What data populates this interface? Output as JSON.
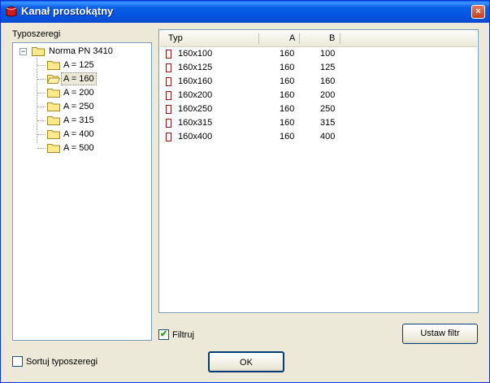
{
  "window": {
    "title": "Kanał prostokątny",
    "close_glyph": "×"
  },
  "left": {
    "label": "Typoszeregi",
    "tree": {
      "root": {
        "label": "Norma PN 3410",
        "expander": "−",
        "icon": "folder-icon"
      },
      "children": [
        {
          "label": "A = 125"
        },
        {
          "label": "A = 160",
          "selected": true
        },
        {
          "label": "A = 200"
        },
        {
          "label": "A = 250"
        },
        {
          "label": "A = 315"
        },
        {
          "label": "A = 400"
        },
        {
          "label": "A = 500"
        }
      ]
    },
    "sort_checkbox": {
      "label": "Sortuj typoszeregi",
      "checked": false
    }
  },
  "right": {
    "columns": [
      "Typ",
      "A",
      "B"
    ],
    "rows": [
      {
        "typ": "160x100",
        "a": "160",
        "b": "100"
      },
      {
        "typ": "160x125",
        "a": "160",
        "b": "125"
      },
      {
        "typ": "160x160",
        "a": "160",
        "b": "160"
      },
      {
        "typ": "160x200",
        "a": "160",
        "b": "200"
      },
      {
        "typ": "160x250",
        "a": "160",
        "b": "250"
      },
      {
        "typ": "160x315",
        "a": "160",
        "b": "315"
      },
      {
        "typ": "160x400",
        "a": "160",
        "b": "400"
      }
    ],
    "filter_checkbox": {
      "label": "Filtruj",
      "checked": true,
      "mark": "✔"
    },
    "set_filter_button": "Ustaw filtr"
  },
  "ok_button": "OK",
  "colors": {
    "title_bar": "#0a5fe6",
    "close": "#d3582f",
    "row_icon": "#8c1a1a",
    "check": "#21a121"
  }
}
